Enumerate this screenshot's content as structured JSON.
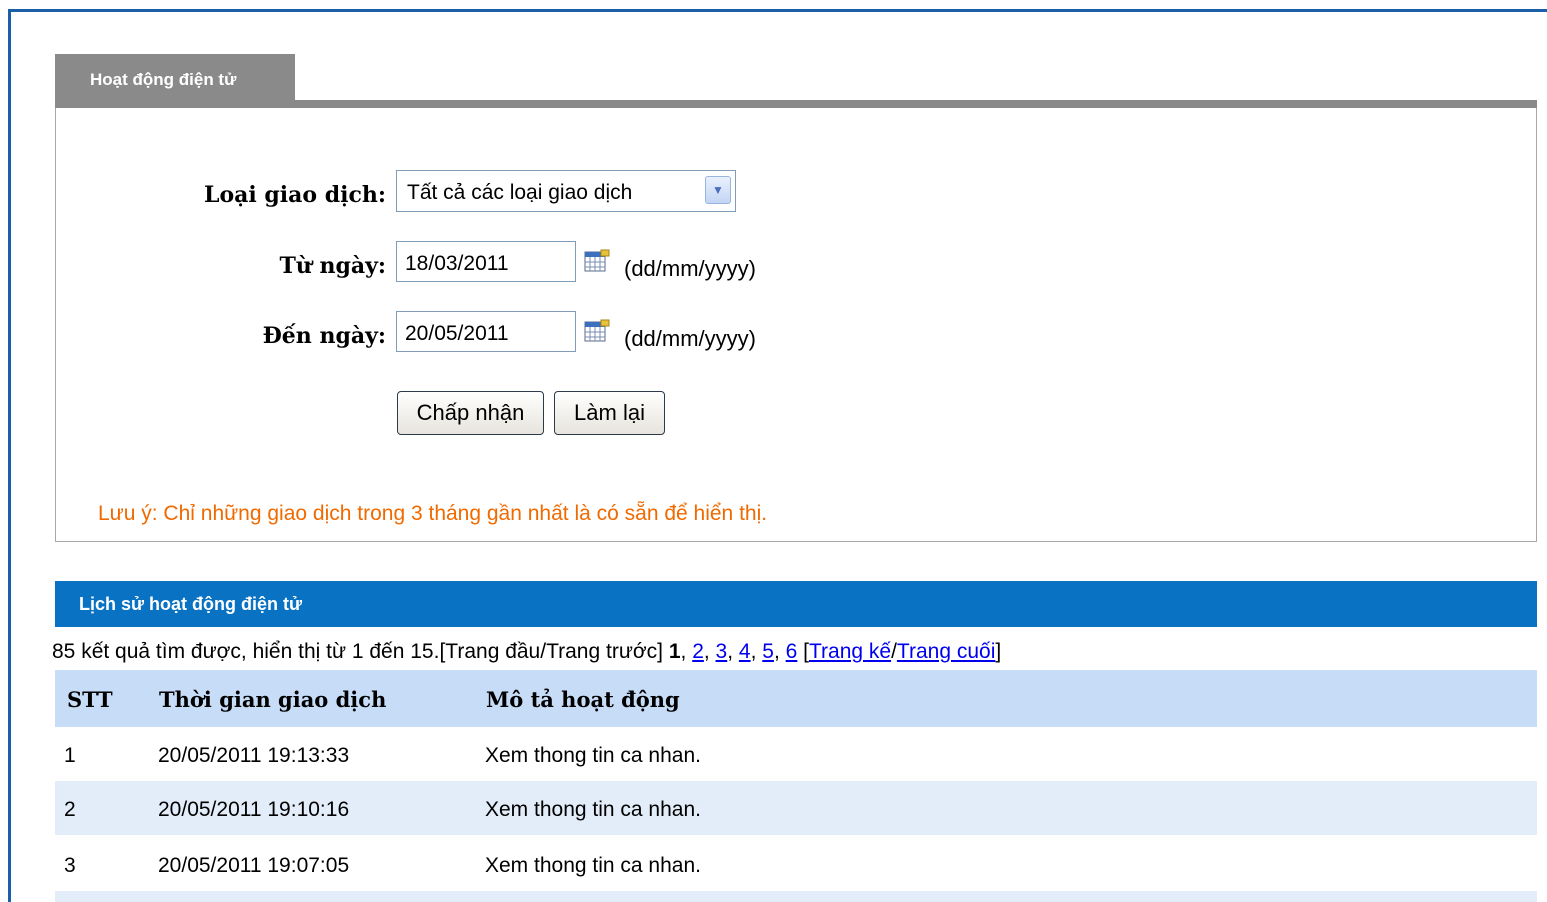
{
  "tab": {
    "title": "Hoạt động điện tử"
  },
  "form": {
    "type_label": "Loại giao dịch:",
    "type_value": "Tất cả các loại giao dịch",
    "from_label": "Từ ngày:",
    "from_value": "18/03/2011",
    "to_label": "Đến ngày:",
    "to_value": "20/05/2011",
    "date_hint": "(dd/mm/yyyy)",
    "accept_label": "Chấp nhận",
    "reset_label": "Làm lại",
    "note": "Lưu ý: Chỉ những giao dịch trong 3 tháng gần nhất là có sẵn để hiển thị."
  },
  "history": {
    "title": "Lịch sử hoạt động điện tử",
    "summary": "85 kết quả tìm được, hiển thị từ 1 đến 15.",
    "first_prev": "[Trang đầu/Trang trước]",
    "current_page": "1",
    "pages": [
      "2",
      "3",
      "4",
      "5",
      "6"
    ],
    "next_label": "Trang kế",
    "last_label": "Trang cuối",
    "columns": [
      "STT",
      "Thời gian giao dịch",
      "Mô tả hoạt động"
    ],
    "rows": [
      {
        "stt": "1",
        "time": "20/05/2011 19:13:33",
        "desc": "Xem thong tin ca nhan."
      },
      {
        "stt": "2",
        "time": "20/05/2011 19:10:16",
        "desc": "Xem thong tin ca nhan."
      },
      {
        "stt": "3",
        "time": "20/05/2011 19:07:05",
        "desc": "Xem thong tin ca nhan."
      }
    ]
  }
}
